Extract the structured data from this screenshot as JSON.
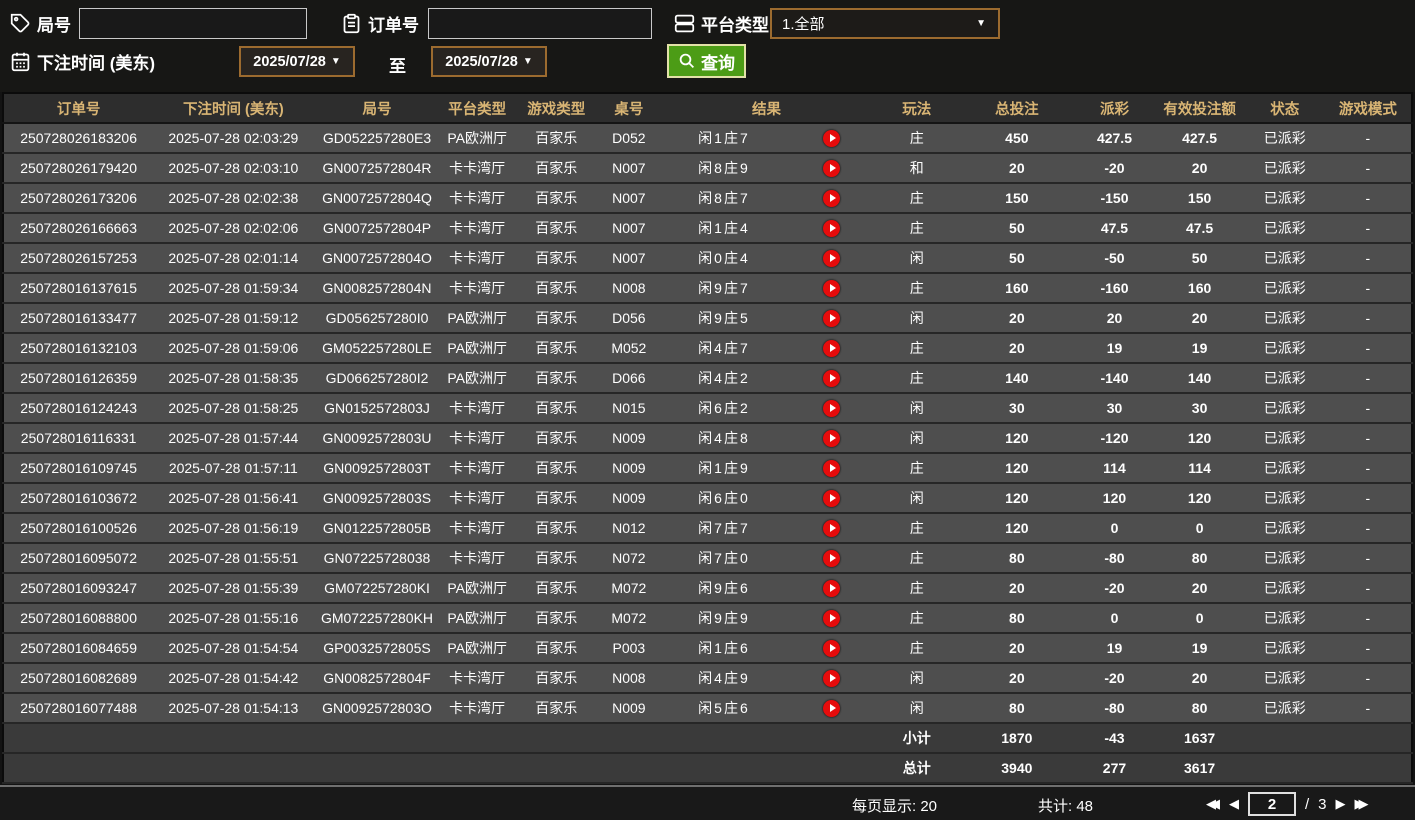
{
  "filters": {
    "round_label": "局号",
    "round_value": "",
    "order_label": "订单号",
    "order_value": "",
    "platform_label": "平台类型",
    "platform_value": "1.全部",
    "bet_time_label": "下注时间 (美东)",
    "date_from": "2025/07/28",
    "to_label": "至",
    "date_to": "2025/07/28",
    "search_label": "查询"
  },
  "icons": {
    "round": "tag-icon",
    "order": "clipboard-icon",
    "platform": "server-icon",
    "bet_time": "calendar-icon",
    "search": "magnifier-icon",
    "play": "play-icon"
  },
  "colors": {
    "search_button_green": "#4c9c16",
    "payout_positive_red": "#b80f3a",
    "payout_negative_green": "#63d414",
    "status_paid_green": "#2ecc2e",
    "totals_yellow": "#e4e400",
    "header_gold": "#d9b574",
    "picker_border_orange": "#9c6b2f",
    "play_icon_red": "#e60c0c"
  },
  "table": {
    "headers": [
      "订单号",
      "下注时间 (美东)",
      "局号",
      "平台类型",
      "游戏类型",
      "桌号",
      "结果",
      "玩法",
      "总投注",
      "派彩",
      "有效投注额",
      "状态",
      "游戏模式"
    ],
    "rows": [
      {
        "order_no": "250728026183206",
        "bet_time": "2025-07-28 02:03:29",
        "round_no": "GD052257280E3",
        "platform": "PA欧洲厅",
        "game_type": "百家乐",
        "table_no": "D052",
        "result": "闲1庄7",
        "play_type": "庄",
        "total_bet": "450",
        "payout": "427.5",
        "payout_type": "pos",
        "valid_bet": "427.5",
        "status": "已派彩",
        "game_mode": "-"
      },
      {
        "order_no": "250728026179420",
        "bet_time": "2025-07-28 02:03:10",
        "round_no": "GN0072572804R",
        "platform": "卡卡湾厅",
        "game_type": "百家乐",
        "table_no": "N007",
        "result": "闲8庄9",
        "play_type": "和",
        "total_bet": "20",
        "payout": "-20",
        "payout_type": "neg",
        "valid_bet": "20",
        "status": "已派彩",
        "game_mode": "-"
      },
      {
        "order_no": "250728026173206",
        "bet_time": "2025-07-28 02:02:38",
        "round_no": "GN0072572804Q",
        "platform": "卡卡湾厅",
        "game_type": "百家乐",
        "table_no": "N007",
        "result": "闲8庄7",
        "play_type": "庄",
        "total_bet": "150",
        "payout": "-150",
        "payout_type": "neg",
        "valid_bet": "150",
        "status": "已派彩",
        "game_mode": "-"
      },
      {
        "order_no": "250728026166663",
        "bet_time": "2025-07-28 02:02:06",
        "round_no": "GN0072572804P",
        "platform": "卡卡湾厅",
        "game_type": "百家乐",
        "table_no": "N007",
        "result": "闲1庄4",
        "play_type": "庄",
        "total_bet": "50",
        "payout": "47.5",
        "payout_type": "pos",
        "valid_bet": "47.5",
        "status": "已派彩",
        "game_mode": "-"
      },
      {
        "order_no": "250728026157253",
        "bet_time": "2025-07-28 02:01:14",
        "round_no": "GN0072572804O",
        "platform": "卡卡湾厅",
        "game_type": "百家乐",
        "table_no": "N007",
        "result": "闲0庄4",
        "play_type": "闲",
        "total_bet": "50",
        "payout": "-50",
        "payout_type": "neg",
        "valid_bet": "50",
        "status": "已派彩",
        "game_mode": "-"
      },
      {
        "order_no": "250728016137615",
        "bet_time": "2025-07-28 01:59:34",
        "round_no": "GN0082572804N",
        "platform": "卡卡湾厅",
        "game_type": "百家乐",
        "table_no": "N008",
        "result": "闲9庄7",
        "play_type": "庄",
        "total_bet": "160",
        "payout": "-160",
        "payout_type": "neg",
        "valid_bet": "160",
        "status": "已派彩",
        "game_mode": "-"
      },
      {
        "order_no": "250728016133477",
        "bet_time": "2025-07-28 01:59:12",
        "round_no": "GD056257280I0",
        "platform": "PA欧洲厅",
        "game_type": "百家乐",
        "table_no": "D056",
        "result": "闲9庄5",
        "play_type": "闲",
        "total_bet": "20",
        "payout": "20",
        "payout_type": "pos",
        "valid_bet": "20",
        "status": "已派彩",
        "game_mode": "-"
      },
      {
        "order_no": "250728016132103",
        "bet_time": "2025-07-28 01:59:06",
        "round_no": "GM052257280LE",
        "platform": "PA欧洲厅",
        "game_type": "百家乐",
        "table_no": "M052",
        "result": "闲4庄7",
        "play_type": "庄",
        "total_bet": "20",
        "payout": "19",
        "payout_type": "pos",
        "valid_bet": "19",
        "status": "已派彩",
        "game_mode": "-"
      },
      {
        "order_no": "250728016126359",
        "bet_time": "2025-07-28 01:58:35",
        "round_no": "GD066257280I2",
        "platform": "PA欧洲厅",
        "game_type": "百家乐",
        "table_no": "D066",
        "result": "闲4庄2",
        "play_type": "庄",
        "total_bet": "140",
        "payout": "-140",
        "payout_type": "neg",
        "valid_bet": "140",
        "status": "已派彩",
        "game_mode": "-"
      },
      {
        "order_no": "250728016124243",
        "bet_time": "2025-07-28 01:58:25",
        "round_no": "GN0152572803J",
        "platform": "卡卡湾厅",
        "game_type": "百家乐",
        "table_no": "N015",
        "result": "闲6庄2",
        "play_type": "闲",
        "total_bet": "30",
        "payout": "30",
        "payout_type": "pos",
        "valid_bet": "30",
        "status": "已派彩",
        "game_mode": "-"
      },
      {
        "order_no": "250728016116331",
        "bet_time": "2025-07-28 01:57:44",
        "round_no": "GN0092572803U",
        "platform": "卡卡湾厅",
        "game_type": "百家乐",
        "table_no": "N009",
        "result": "闲4庄8",
        "play_type": "闲",
        "total_bet": "120",
        "payout": "-120",
        "payout_type": "neg",
        "valid_bet": "120",
        "status": "已派彩",
        "game_mode": "-"
      },
      {
        "order_no": "250728016109745",
        "bet_time": "2025-07-28 01:57:11",
        "round_no": "GN0092572803T",
        "platform": "卡卡湾厅",
        "game_type": "百家乐",
        "table_no": "N009",
        "result": "闲1庄9",
        "play_type": "庄",
        "total_bet": "120",
        "payout": "114",
        "payout_type": "pos",
        "valid_bet": "114",
        "status": "已派彩",
        "game_mode": "-"
      },
      {
        "order_no": "250728016103672",
        "bet_time": "2025-07-28 01:56:41",
        "round_no": "GN0092572803S",
        "platform": "卡卡湾厅",
        "game_type": "百家乐",
        "table_no": "N009",
        "result": "闲6庄0",
        "play_type": "闲",
        "total_bet": "120",
        "payout": "120",
        "payout_type": "pos",
        "valid_bet": "120",
        "status": "已派彩",
        "game_mode": "-"
      },
      {
        "order_no": "250728016100526",
        "bet_time": "2025-07-28 01:56:19",
        "round_no": "GN0122572805B",
        "platform": "卡卡湾厅",
        "game_type": "百家乐",
        "table_no": "N012",
        "result": "闲7庄7",
        "play_type": "庄",
        "total_bet": "120",
        "payout": "0",
        "payout_type": "zero",
        "valid_bet": "0",
        "status": "已派彩",
        "game_mode": "-"
      },
      {
        "order_no": "250728016095072",
        "bet_time": "2025-07-28 01:55:51",
        "round_no": "GN07225728038",
        "platform": "卡卡湾厅",
        "game_type": "百家乐",
        "table_no": "N072",
        "result": "闲7庄0",
        "play_type": "庄",
        "total_bet": "80",
        "payout": "-80",
        "payout_type": "neg",
        "valid_bet": "80",
        "status": "已派彩",
        "game_mode": "-"
      },
      {
        "order_no": "250728016093247",
        "bet_time": "2025-07-28 01:55:39",
        "round_no": "GM072257280KI",
        "platform": "PA欧洲厅",
        "game_type": "百家乐",
        "table_no": "M072",
        "result": "闲9庄6",
        "play_type": "庄",
        "total_bet": "20",
        "payout": "-20",
        "payout_type": "neg",
        "valid_bet": "20",
        "status": "已派彩",
        "game_mode": "-"
      },
      {
        "order_no": "250728016088800",
        "bet_time": "2025-07-28 01:55:16",
        "round_no": "GM072257280KH",
        "platform": "PA欧洲厅",
        "game_type": "百家乐",
        "table_no": "M072",
        "result": "闲9庄9",
        "play_type": "庄",
        "total_bet": "80",
        "payout": "0",
        "payout_type": "zero",
        "valid_bet": "0",
        "status": "已派彩",
        "game_mode": "-"
      },
      {
        "order_no": "250728016084659",
        "bet_time": "2025-07-28 01:54:54",
        "round_no": "GP0032572805S",
        "platform": "PA欧洲厅",
        "game_type": "百家乐",
        "table_no": "P003",
        "result": "闲1庄6",
        "play_type": "庄",
        "total_bet": "20",
        "payout": "19",
        "payout_type": "pos",
        "valid_bet": "19",
        "status": "已派彩",
        "game_mode": "-"
      },
      {
        "order_no": "250728016082689",
        "bet_time": "2025-07-28 01:54:42",
        "round_no": "GN0082572804F",
        "platform": "卡卡湾厅",
        "game_type": "百家乐",
        "table_no": "N008",
        "result": "闲4庄9",
        "play_type": "闲",
        "total_bet": "20",
        "payout": "-20",
        "payout_type": "neg",
        "valid_bet": "20",
        "status": "已派彩",
        "game_mode": "-"
      },
      {
        "order_no": "250728016077488",
        "bet_time": "2025-07-28 01:54:13",
        "round_no": "GN0092572803O",
        "platform": "卡卡湾厅",
        "game_type": "百家乐",
        "table_no": "N009",
        "result": "闲5庄6",
        "play_type": "闲",
        "total_bet": "80",
        "payout": "-80",
        "payout_type": "neg",
        "valid_bet": "80",
        "status": "已派彩",
        "game_mode": "-"
      }
    ],
    "subtotal": {
      "label": "小计",
      "total_bet": "1870",
      "payout": "-43",
      "valid_bet": "1637"
    },
    "grand_total": {
      "label": "总计",
      "total_bet": "3940",
      "payout": "277",
      "valid_bet": "3617"
    }
  },
  "footer": {
    "per_page_label": "每页显示: 20",
    "total_count_label": "共计: 48",
    "page_current": "2",
    "page_separator": "/",
    "page_total": "3"
  }
}
